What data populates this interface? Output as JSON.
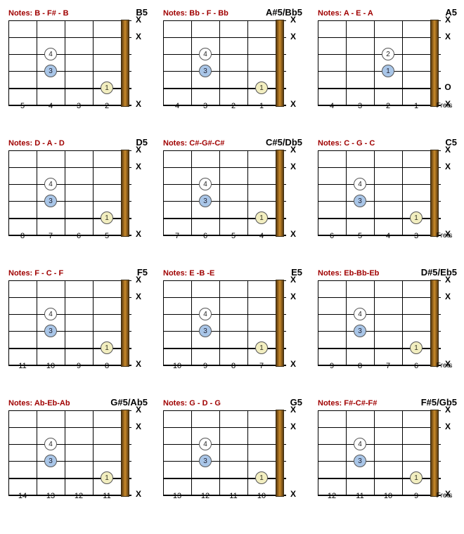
{
  "fret_label_text": "Frets",
  "chords": [
    {
      "name": "B5",
      "notes": "Notes: B - F# - B",
      "frets": [
        "5",
        "4",
        "3",
        "2"
      ],
      "show_frets_label": false,
      "marks": [
        "X",
        "X",
        "",
        "",
        "",
        "X"
      ],
      "dots": [
        {
          "string": 2,
          "col": 1,
          "finger": "4",
          "color": "white"
        },
        {
          "string": 3,
          "col": 1,
          "finger": "3",
          "color": "blue"
        },
        {
          "string": 4,
          "col": 3,
          "finger": "1",
          "color": "yellow"
        }
      ]
    },
    {
      "name": "A#5/Bb5",
      "notes": "Notes: Bb - F - Bb",
      "frets": [
        "4",
        "3",
        "2",
        "1"
      ],
      "show_frets_label": false,
      "marks": [
        "X",
        "X",
        "",
        "",
        "",
        "X"
      ],
      "dots": [
        {
          "string": 2,
          "col": 1,
          "finger": "4",
          "color": "white"
        },
        {
          "string": 3,
          "col": 1,
          "finger": "3",
          "color": "blue"
        },
        {
          "string": 4,
          "col": 3,
          "finger": "1",
          "color": "yellow"
        }
      ]
    },
    {
      "name": "A5",
      "notes": "Notes: A - E - A",
      "frets": [
        "4",
        "3",
        "2",
        "1"
      ],
      "show_frets_label": true,
      "marks": [
        "X",
        "X",
        "",
        "",
        "O",
        "X"
      ],
      "dots": [
        {
          "string": 2,
          "col": 2,
          "finger": "2",
          "color": "white"
        },
        {
          "string": 3,
          "col": 2,
          "finger": "1",
          "color": "blue"
        }
      ]
    },
    {
      "name": "D5",
      "notes": "Notes: D - A - D",
      "frets": [
        "8",
        "7",
        "6",
        "5"
      ],
      "show_frets_label": false,
      "marks": [
        "X",
        "X",
        "",
        "",
        "",
        "X"
      ],
      "dots": [
        {
          "string": 2,
          "col": 1,
          "finger": "4",
          "color": "white"
        },
        {
          "string": 3,
          "col": 1,
          "finger": "3",
          "color": "blue"
        },
        {
          "string": 4,
          "col": 3,
          "finger": "1",
          "color": "yellow"
        }
      ]
    },
    {
      "name": "C#5/Db5",
      "notes": "Notes: C#-G#-C#",
      "frets": [
        "7",
        "6",
        "5",
        "4"
      ],
      "show_frets_label": false,
      "marks": [
        "X",
        "X",
        "",
        "",
        "",
        "X"
      ],
      "dots": [
        {
          "string": 2,
          "col": 1,
          "finger": "4",
          "color": "white"
        },
        {
          "string": 3,
          "col": 1,
          "finger": "3",
          "color": "blue"
        },
        {
          "string": 4,
          "col": 3,
          "finger": "1",
          "color": "yellow"
        }
      ]
    },
    {
      "name": "C5",
      "notes": "Notes: C - G - C",
      "frets": [
        "6",
        "5",
        "4",
        "3"
      ],
      "show_frets_label": true,
      "marks": [
        "X",
        "X",
        "",
        "",
        "",
        "X"
      ],
      "dots": [
        {
          "string": 2,
          "col": 1,
          "finger": "4",
          "color": "white"
        },
        {
          "string": 3,
          "col": 1,
          "finger": "3",
          "color": "blue"
        },
        {
          "string": 4,
          "col": 3,
          "finger": "1",
          "color": "yellow"
        }
      ]
    },
    {
      "name": "F5",
      "notes": "Notes: F - C - F",
      "frets": [
        "11",
        "10",
        "9",
        "8"
      ],
      "show_frets_label": false,
      "marks": [
        "X",
        "X",
        "",
        "",
        "",
        "X"
      ],
      "dots": [
        {
          "string": 2,
          "col": 1,
          "finger": "4",
          "color": "white"
        },
        {
          "string": 3,
          "col": 1,
          "finger": "3",
          "color": "blue"
        },
        {
          "string": 4,
          "col": 3,
          "finger": "1",
          "color": "yellow"
        }
      ]
    },
    {
      "name": "E5",
      "notes": "Notes: E -B -E",
      "frets": [
        "10",
        "9",
        "8",
        "7"
      ],
      "show_frets_label": false,
      "marks": [
        "X",
        "X",
        "",
        "",
        "",
        "X"
      ],
      "dots": [
        {
          "string": 2,
          "col": 1,
          "finger": "4",
          "color": "white"
        },
        {
          "string": 3,
          "col": 1,
          "finger": "3",
          "color": "blue"
        },
        {
          "string": 4,
          "col": 3,
          "finger": "1",
          "color": "yellow"
        }
      ]
    },
    {
      "name": "D#5/Eb5",
      "notes": "Notes: Eb-Bb-Eb",
      "frets": [
        "9",
        "8",
        "7",
        "6"
      ],
      "show_frets_label": true,
      "marks": [
        "X",
        "X",
        "",
        "",
        "",
        "X"
      ],
      "dots": [
        {
          "string": 2,
          "col": 1,
          "finger": "4",
          "color": "white"
        },
        {
          "string": 3,
          "col": 1,
          "finger": "3",
          "color": "blue"
        },
        {
          "string": 4,
          "col": 3,
          "finger": "1",
          "color": "yellow"
        }
      ]
    },
    {
      "name": "G#5/Ab5",
      "notes": "Notes: Ab-Eb-Ab",
      "frets": [
        "14",
        "13",
        "12",
        "11"
      ],
      "show_frets_label": false,
      "marks": [
        "X",
        "X",
        "",
        "",
        "",
        "X"
      ],
      "dots": [
        {
          "string": 2,
          "col": 1,
          "finger": "4",
          "color": "white"
        },
        {
          "string": 3,
          "col": 1,
          "finger": "3",
          "color": "blue"
        },
        {
          "string": 4,
          "col": 3,
          "finger": "1",
          "color": "yellow"
        }
      ]
    },
    {
      "name": "G5",
      "notes": "Notes: G - D - G",
      "frets": [
        "13",
        "12",
        "11",
        "10"
      ],
      "show_frets_label": false,
      "marks": [
        "X",
        "X",
        "",
        "",
        "",
        "X"
      ],
      "dots": [
        {
          "string": 2,
          "col": 1,
          "finger": "4",
          "color": "white"
        },
        {
          "string": 3,
          "col": 1,
          "finger": "3",
          "color": "blue"
        },
        {
          "string": 4,
          "col": 3,
          "finger": "1",
          "color": "yellow"
        }
      ]
    },
    {
      "name": "F#5/Gb5",
      "notes": "Notes: F#-C#-F#",
      "frets": [
        "12",
        "11",
        "10",
        "9"
      ],
      "show_frets_label": true,
      "marks": [
        "X",
        "X",
        "",
        "",
        "",
        "X"
      ],
      "dots": [
        {
          "string": 2,
          "col": 1,
          "finger": "4",
          "color": "white"
        },
        {
          "string": 3,
          "col": 1,
          "finger": "3",
          "color": "blue"
        },
        {
          "string": 4,
          "col": 3,
          "finger": "1",
          "color": "yellow"
        }
      ]
    }
  ]
}
